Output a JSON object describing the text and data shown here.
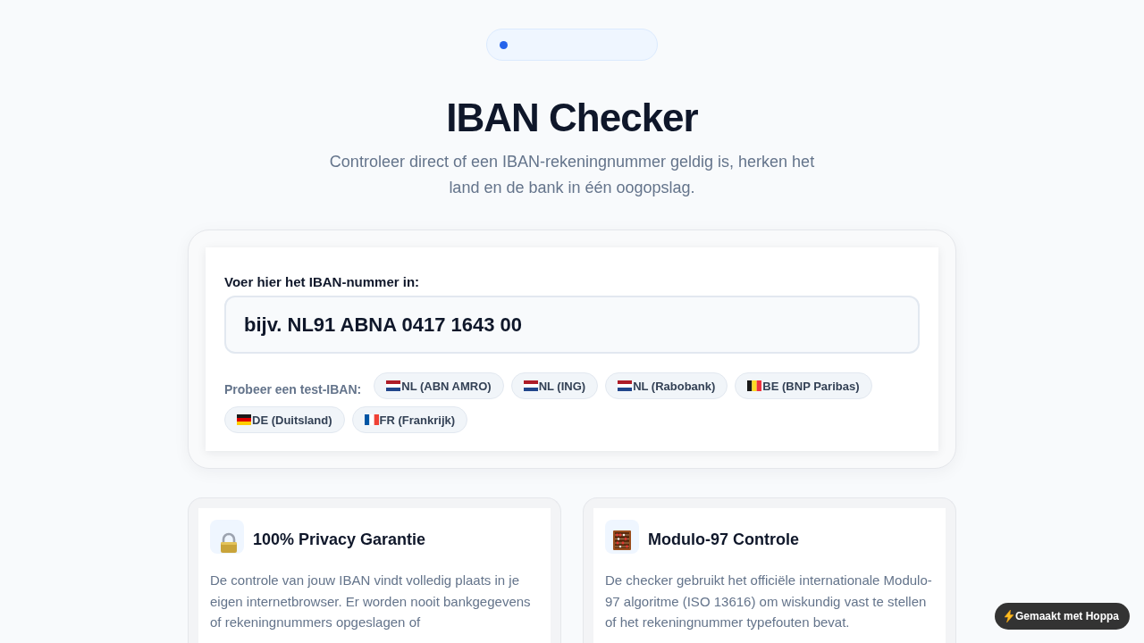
{
  "header": {
    "title": "IBAN Checker",
    "subtitle": "Controleer direct of een IBAN-rekeningnummer geldig is, herken het land en de bank in één oogopslag."
  },
  "iban_form": {
    "label": "Voer hier het IBAN-nummer in:",
    "input": {
      "placeholder": "bijv. NL91 ABNA 0417 1643 00"
    },
    "examples_label": "Probeer een test-IBAN:",
    "examples": [
      {
        "kind": "nl",
        "label": "NL (ABN AMRO)"
      },
      {
        "kind": "nl",
        "label": "NL (ING)"
      },
      {
        "kind": "nl",
        "label": "NL (Rabobank)"
      },
      {
        "kind": "be",
        "label": "BE (BNP Paribas)"
      },
      {
        "kind": "de",
        "label": "DE (Duitsland)"
      },
      {
        "kind": "fr",
        "label": "FR (Frankrijk)"
      }
    ]
  },
  "features": [
    {
      "kind": "privacy",
      "title": "100% Privacy Garantie",
      "text": "De controle van jouw IBAN vindt volledig plaats in je eigen internetbrowser. Er worden nooit bankgegevens of rekeningnummers opgeslagen of"
    },
    {
      "kind": "checksum",
      "title": "Modulo-97 Controle",
      "text": "De checker gebruikt het officiële internationale Modulo-97 algoritme (ISO 13616) om wiskundig vast te stellen of het rekeningnummer typefouten bevat."
    }
  ],
  "made_with_badge": {
    "label": "Gemaakt met Hoppa"
  }
}
